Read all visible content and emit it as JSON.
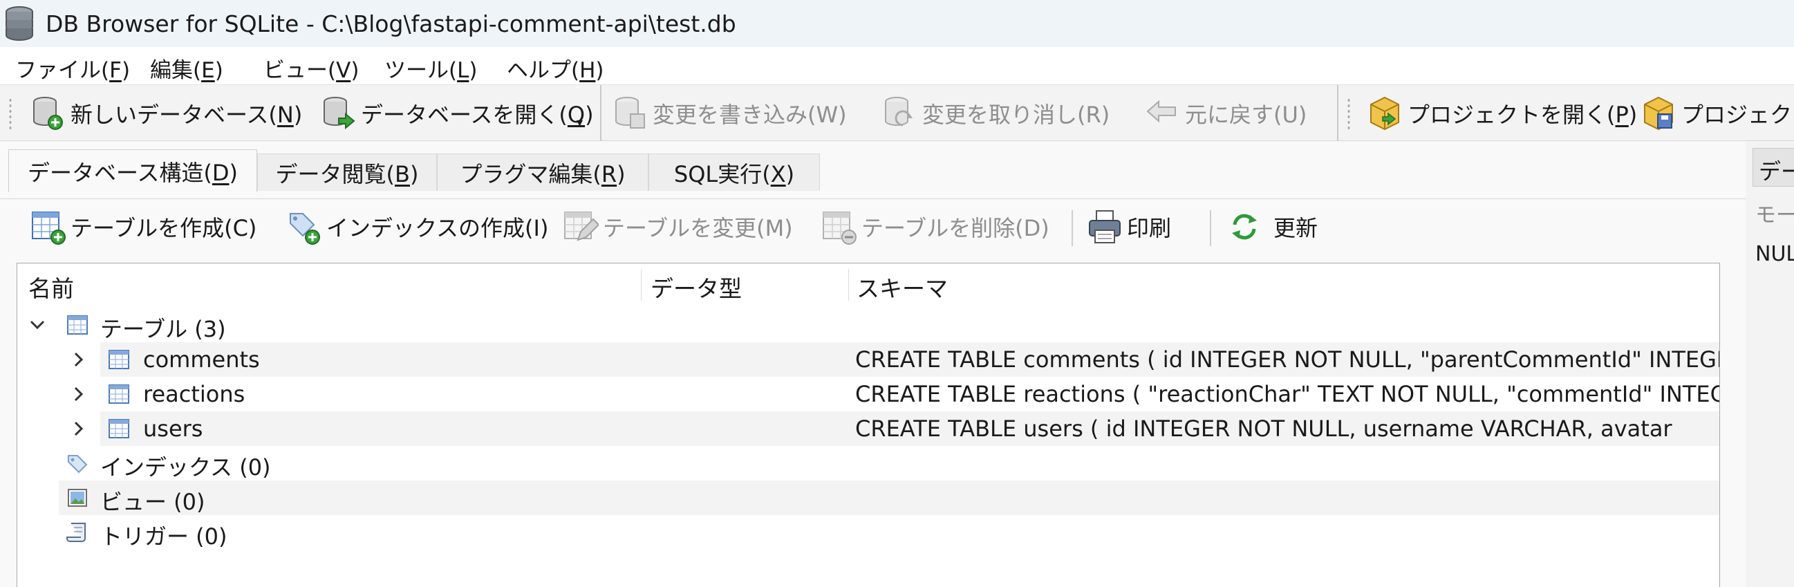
{
  "window": {
    "title": "DB Browser for SQLite - C:\\Blog\\fastapi-comment-api\\test.db"
  },
  "menu": [
    {
      "label": "ファイル(",
      "mnemonic": "F",
      "suffix": ")"
    },
    {
      "label": "編集(",
      "mnemonic": "E",
      "suffix": ")"
    },
    {
      "label": "ビュー(",
      "mnemonic": "V",
      "suffix": ")"
    },
    {
      "label": "ツール(",
      "mnemonic": "L",
      "suffix": ")"
    },
    {
      "label": "ヘルプ(",
      "mnemonic": "H",
      "suffix": ")"
    }
  ],
  "toolbar": {
    "new_db": {
      "label": "新しいデータベース(",
      "mnemonic": "N",
      "suffix": ")"
    },
    "open_db": {
      "label": "データベースを開く(",
      "mnemonic": "O",
      "suffix": ")"
    },
    "write_changes": {
      "label": "変更を書き込み(W)"
    },
    "revert_changes": {
      "label": "変更を取り消し(R)"
    },
    "undo": {
      "label": "元に戻す(U)"
    },
    "open_project": {
      "label": "プロジェクトを開く(",
      "mnemonic": "P",
      "suffix": ")"
    },
    "save_project": {
      "label": "プロジェクト"
    }
  },
  "tabs": [
    {
      "label": "データベース構造(",
      "mnemonic": "D",
      "suffix": ")"
    },
    {
      "label": "データ閲覧(",
      "mnemonic": "B",
      "suffix": ")"
    },
    {
      "label": "プラグマ編集(",
      "mnemonic": "R",
      "suffix": ")"
    },
    {
      "label": "SQL実行(",
      "mnemonic": "X",
      "suffix": ")"
    }
  ],
  "structure_toolbar": {
    "create_table": "テーブルを作成(C)",
    "create_index": "インデックスの作成(I)",
    "modify_table": "テーブルを変更(M)",
    "delete_table": "テーブルを削除(D)",
    "print": "印刷",
    "refresh": "更新"
  },
  "tree": {
    "columns": {
      "name": "名前",
      "type": "データ型",
      "schema": "スキーマ"
    },
    "tables_group": "テーブル (3)",
    "tables": [
      {
        "name": "comments",
        "schema": "CREATE TABLE comments ( id INTEGER NOT NULL, \"parentCommentId\" INTEGER"
      },
      {
        "name": "reactions",
        "schema": "CREATE TABLE reactions ( \"reactionChar\" TEXT NOT NULL, \"commentId\" INTEGER"
      },
      {
        "name": "users",
        "schema": "CREATE TABLE users ( id INTEGER NOT NULL, username VARCHAR, avatar"
      }
    ],
    "indexes_group": "インデックス (0)",
    "views_group": "ビュー (0)",
    "triggers_group": "トリガー (0)"
  },
  "right_dock": {
    "tab_label": "データ",
    "mode_label": "モード",
    "value": "NULL"
  }
}
